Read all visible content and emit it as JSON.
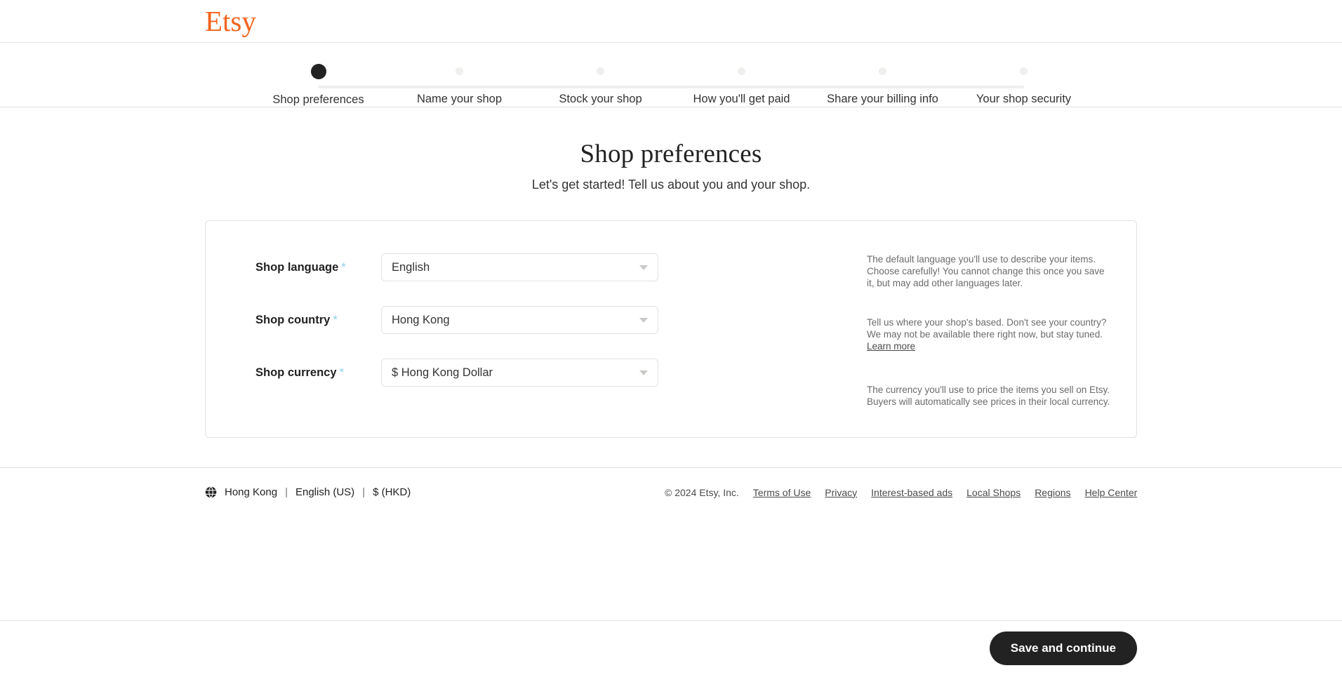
{
  "brand": {
    "logo_text": "Etsy",
    "logo_color": "#f1641e"
  },
  "stepper": {
    "steps": [
      {
        "label": "Shop preferences",
        "state": "active"
      },
      {
        "label": "Name your shop",
        "state": "upcoming"
      },
      {
        "label": "Stock your shop",
        "state": "upcoming"
      },
      {
        "label": "How you'll get paid",
        "state": "upcoming"
      },
      {
        "label": "Share your billing info",
        "state": "upcoming"
      },
      {
        "label": "Your shop security",
        "state": "upcoming"
      }
    ],
    "active_color": "#222222",
    "inactive_color": "#efefed"
  },
  "main": {
    "title": "Shop preferences",
    "subtitle": "Let's get started! Tell us about you and your shop.",
    "required_marker": "*",
    "fields": [
      {
        "label": "Shop language",
        "value": "English",
        "help": "The default language you'll use to describe your items. Choose carefully! You cannot change this once you save it, but may add other languages later.",
        "help_link": ""
      },
      {
        "label": "Shop country",
        "value": "Hong Kong",
        "help": "Tell us where your shop's based. Don't see your country? We may not be available there right now, but stay tuned. ",
        "help_link": "Learn more"
      },
      {
        "label": "Shop currency",
        "value": "$ Hong Kong Dollar",
        "help": "The currency you'll use to price the items you sell on Etsy. Buyers will automatically see prices in their local currency.",
        "help_link": ""
      }
    ]
  },
  "footer": {
    "locale": {
      "icon": "globe-icon",
      "region": "Hong Kong",
      "language": "English (US)",
      "currency": "$ (HKD)",
      "separator": "|"
    },
    "copyright": "© 2024 Etsy, Inc.",
    "links": [
      "Terms of Use",
      "Privacy",
      "Interest-based ads",
      "Local Shops",
      "Regions",
      "Help Center"
    ]
  },
  "bottom_bar": {
    "primary_button": "Save and continue"
  }
}
